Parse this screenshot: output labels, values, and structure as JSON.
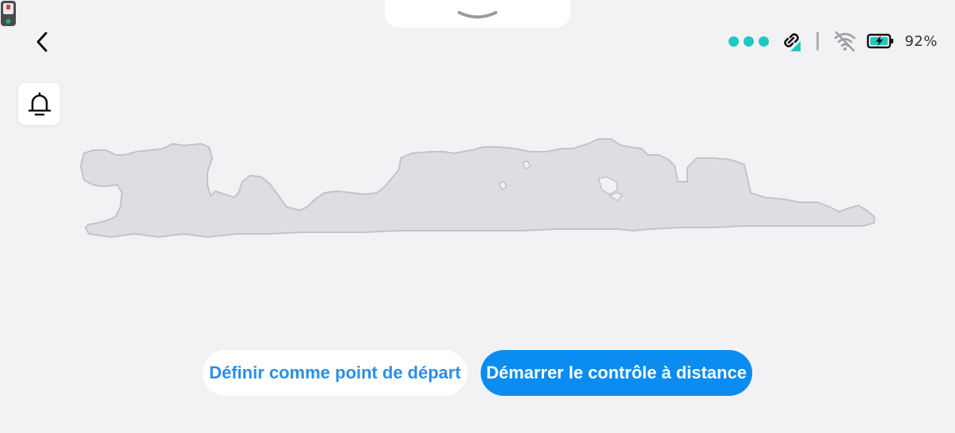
{
  "top_handle": {
    "icon": "chevron-down-icon"
  },
  "nav": {
    "back_icon": "chevron-left-icon"
  },
  "status": {
    "connection_dots": 3,
    "dot_color": "#1ec8c0",
    "link_icon": "link-signal-icon",
    "wifi_icon": "wifi-off-icon",
    "battery_icon": "battery-charging-icon",
    "battery_percent": "92%"
  },
  "notifications": {
    "icon": "bell-icon"
  },
  "map": {
    "robot_icon": "mower-icon",
    "map_fill": "#dedee2",
    "map_stroke": "#c4c4c8"
  },
  "actions": {
    "set_start_label": "Définir comme point de départ",
    "remote_control_label": "Démarrer le contrôle à distance"
  },
  "colors": {
    "accent": "#0a8cf0",
    "background": "#f2f2f4"
  }
}
